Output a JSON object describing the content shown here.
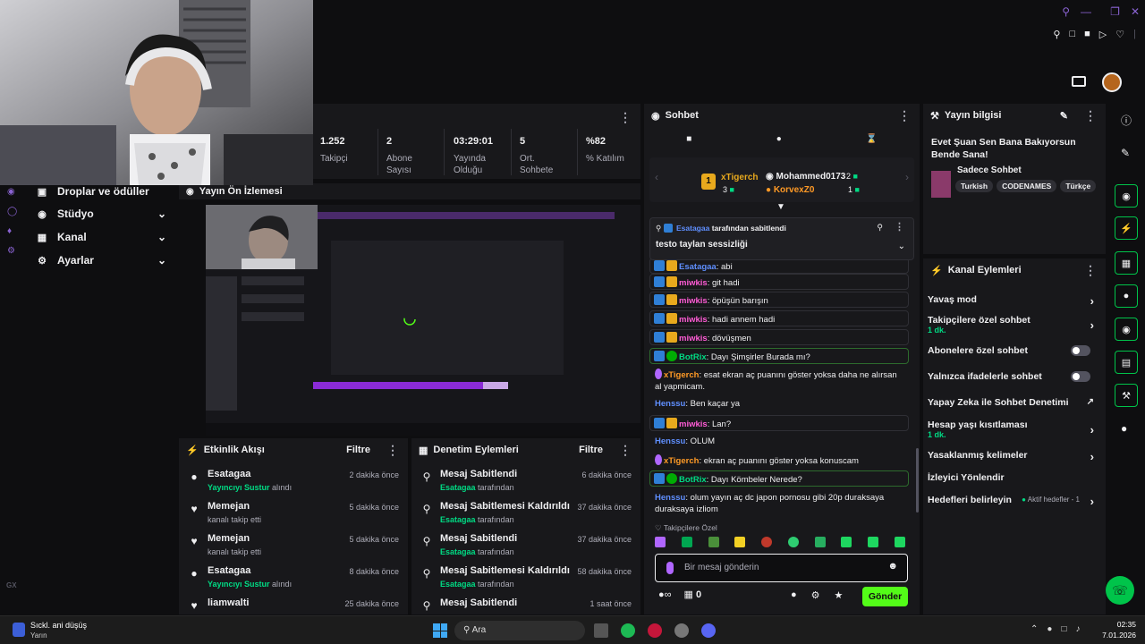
{
  "stats": [
    {
      "value": "1.252",
      "label": "Takipçi"
    },
    {
      "value": "2",
      "label": "Abone Sayısı"
    },
    {
      "value": "03:29:01",
      "label": "Yayında Olduğu"
    },
    {
      "value": "5",
      "label": "Ort. Sohbete"
    },
    {
      "value": "%82",
      "label": "% Katılım"
    }
  ],
  "nav": {
    "items": [
      {
        "label": "Droplar ve ödüller",
        "icon": "gift-icon"
      },
      {
        "label": "Stüdyo",
        "icon": "studio-icon"
      },
      {
        "label": "Kanal",
        "icon": "channel-icon"
      },
      {
        "label": "Ayarlar",
        "icon": "gear-icon"
      }
    ]
  },
  "preview": {
    "title": "Yayın Ön İzlemesi"
  },
  "activity": {
    "title": "Etkinlik Akışı",
    "filter": "Filtre",
    "rows": [
      {
        "name": "Esatagaa",
        "detail_strong": "Yayıncıyı Sustur",
        "detail": "alındı",
        "time": "2 dakika önce",
        "icon": "bits-icon"
      },
      {
        "name": "Memejan",
        "detail_strong": "",
        "detail": "kanalı takip etti",
        "time": "5 dakika önce",
        "icon": "heart-icon"
      },
      {
        "name": "Memejan",
        "detail_strong": "",
        "detail": "kanalı takip etti",
        "time": "5 dakika önce",
        "icon": "heart-icon"
      },
      {
        "name": "Esatagaa",
        "detail_strong": "Yayıncıyı Sustur",
        "detail": "alındı",
        "time": "8 dakika önce",
        "icon": "bits-icon"
      },
      {
        "name": "liamwalti",
        "detail_strong": "",
        "detail": "",
        "time": "25 dakika önce",
        "icon": "heart-icon"
      }
    ]
  },
  "moderation": {
    "title": "Denetim Eylemleri",
    "filter": "Filtre",
    "rows": [
      {
        "name": "Mesaj Sabitlendi",
        "detail_strong": "Esatagaa",
        "detail": "tarafından",
        "time": "6 dakika önce",
        "icon": "pin-icon"
      },
      {
        "name": "Mesaj Sabitlemesi Kaldırıldı",
        "detail_strong": "Esatagaa",
        "detail": "tarafından",
        "time": "37 dakika önce",
        "icon": "unpin-icon"
      },
      {
        "name": "Mesaj Sabitlendi",
        "detail_strong": "Esatagaa",
        "detail": "tarafından",
        "time": "37 dakika önce",
        "icon": "pin-icon"
      },
      {
        "name": "Mesaj Sabitlemesi Kaldırıldı",
        "detail_strong": "Esatagaa",
        "detail": "tarafından",
        "time": "58 dakika önce",
        "icon": "unpin-icon"
      },
      {
        "name": "Mesaj Sabitlendi",
        "detail_strong": "",
        "detail": "",
        "time": "1 saat önce",
        "icon": "pin-icon"
      }
    ]
  },
  "chat": {
    "title": "Sohbet",
    "leaderboard": {
      "rank": "1",
      "first": {
        "name": "xTigerch",
        "count": "3"
      },
      "second": {
        "name": "Mohammed0173",
        "count": "2"
      },
      "third": {
        "name": "KorvexZ0",
        "count": "1"
      }
    },
    "pinned": {
      "by": "Esatagaa",
      "by_suffix": "tarafından sabitlendi",
      "text": "testo taylan sessizliği"
    },
    "messages": [
      {
        "user": "Esatagaa",
        "text": "abi",
        "style": "es",
        "boxed": true,
        "badges": [
          "mod",
          "crown"
        ]
      },
      {
        "user": "miwkis",
        "text": "git hadi",
        "style": "mv",
        "boxed": true,
        "badges": [
          "mod",
          "crown"
        ]
      },
      {
        "user": "miwkis",
        "text": "öpüşün barışın",
        "style": "mv",
        "boxed": true,
        "badges": [
          "mod",
          "crown"
        ]
      },
      {
        "user": "miwkis",
        "text": "hadi annem hadi",
        "style": "mv",
        "boxed": true,
        "badges": [
          "mod",
          "crown"
        ]
      },
      {
        "user": "miwkis",
        "text": "dövüşmen",
        "style": "mv",
        "boxed": true,
        "badges": [
          "mod",
          "crown"
        ]
      },
      {
        "user": "BotRix",
        "text": "Dayı Şimşirler Burada mı?",
        "style": "bot",
        "boxed": true,
        "badges": [
          "mod",
          "ver"
        ]
      },
      {
        "user": "xTigerch",
        "text": "esat ekran aç puanını göster yoksa daha ne alırsan al yapmicam.",
        "style": "xt",
        "boxed": false,
        "badges": [
          "mic"
        ]
      },
      {
        "user": "Henssu",
        "text": "Ben kaçar ya",
        "style": "hs",
        "boxed": false,
        "badges": []
      },
      {
        "user": "miwkis",
        "text": "Lan?",
        "style": "mv",
        "boxed": true,
        "badges": [
          "mod",
          "crown"
        ]
      },
      {
        "user": "Henssu",
        "text": "OLUM",
        "style": "hs",
        "boxed": false,
        "badges": []
      },
      {
        "user": "xTigerch",
        "text": "ekran aç puanını göster yoksa konuscam",
        "style": "xt",
        "boxed": false,
        "badges": [
          "mic"
        ]
      },
      {
        "user": "BotRix",
        "text": "Dayı Kömbeler Nerede?",
        "style": "bot",
        "boxed": true,
        "badges": [
          "mod",
          "ver"
        ]
      },
      {
        "user": "Henssu",
        "text": "olum yayın aç dc japon pornosu gibi 20p duraksaya duraksaya izliom",
        "style": "hs",
        "boxed": false,
        "badges": []
      }
    ],
    "followers_only": "Takipçilere Özel",
    "input_placeholder": "Bir mesaj gönderin",
    "points": "0",
    "send_label": "Gönder"
  },
  "stream_info": {
    "title_label": "Yayın bilgisi",
    "stream_title": "Evet Şuan Sen Bana Bakıyorsun Bende Sana!",
    "category": "Sadece Sohbet",
    "tags": [
      "Turkish",
      "CODENAMES",
      "Türkçe"
    ]
  },
  "channel_actions": {
    "title": "Kanal Eylemleri",
    "items": [
      {
        "label": "Yavaş mod",
        "sub": "",
        "control": "chevron"
      },
      {
        "label": "Takipçilere özel sohbet",
        "sub": "1 dk.",
        "control": "chevron"
      },
      {
        "label": "Abonelere özel sohbet",
        "sub": "",
        "control": "toggle"
      },
      {
        "label": "Yalnızca ifadelerle sohbet",
        "sub": "",
        "control": "toggle"
      },
      {
        "label": "Yapay Zeka ile Sohbet Denetimi",
        "sub": "",
        "control": "external"
      },
      {
        "label": "Hesap yaşı kısıtlaması",
        "sub": "1 dk.",
        "control": "chevron"
      },
      {
        "label": "Yasaklanmış kelimeler",
        "sub": "",
        "control": "chevron"
      },
      {
        "label": "İzleyici Yönlendir",
        "sub": "",
        "control": "none"
      },
      {
        "label": "Hedefleri belirleyin",
        "sub": "",
        "control": "chevron",
        "extra": "Aktif hedefler - 1"
      }
    ]
  },
  "taskbar": {
    "weather_title": "Sıckl. ani düşüş",
    "weather_sub": "Yarın",
    "search": "Ara",
    "time": "02:35",
    "date": "7.01.2026"
  },
  "colors": {
    "accent": "#53fc18",
    "background": "#0e0e10",
    "panel": "#18181b",
    "mod": "#2f7fd6",
    "crown": "#e8a91d"
  }
}
